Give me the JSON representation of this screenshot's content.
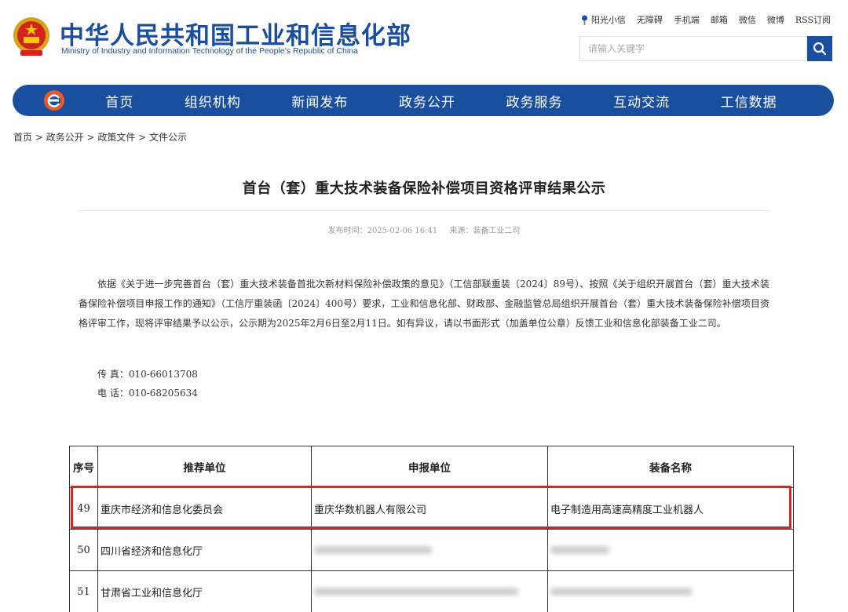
{
  "header": {
    "title": "中华人民共和国工业和信息化部",
    "subtitle": "Ministry of Industry and Information Technology of the People’s Republic of China",
    "emblem_icon": "national-emblem-icon",
    "top_links": [
      "阳光小信",
      "无障碍",
      "手机端",
      "邮箱",
      "微信",
      "微博",
      "RSS订阅"
    ],
    "search": {
      "placeholder": "请输入关键字"
    }
  },
  "nav": {
    "logo_icon": "e-logo-icon",
    "items": [
      "首页",
      "组织机构",
      "新闻发布",
      "政务公开",
      "政务服务",
      "互动交流",
      "工信数据"
    ]
  },
  "breadcrumb": "首页 > 政务公开 > 政策文件 > 文件公示",
  "article": {
    "title": "首台（套）重大技术装备保险补偿项目资格评审结果公示",
    "publish_time": "发布时间：2025-02-06 16:41",
    "source": "来源：装备工业二司",
    "body": "依据《关于进一步完善首台（套）重大技术装备首批次新材料保险补偿政策的意见》（工信部联重装〔2024〕89号）、按照《关于组织开展首台（套）重大技术装备保险补偿项目申报工作的通知》（工信厅重装函〔2024〕400号）要求，工业和信息化部、财政部、金融监管总局组织开展首台（套）重大技术装备保险补偿项目资格评审工作，现将评审结果予以公示，公示期为2025年2月6日至2月11日。如有异议，请以书面形式（加盖单位公章）反馈工业和信息化部装备工业二司。",
    "fax": "传 真：010-66013708",
    "phone": "电 话：010-68205634"
  },
  "table": {
    "headers": [
      "序号",
      "推荐单位",
      "申报单位",
      "装备名称"
    ],
    "rows": [
      {
        "num": "49",
        "recommender": "重庆市经济和信息化委员会",
        "applicant": "重庆华数机器人有限公司",
        "equipment": "电子制造用高速高精度工业机器人"
      },
      {
        "num": "50",
        "recommender": "四川省经济和信息化厅",
        "applicant": "",
        "equipment": ""
      },
      {
        "num": "51",
        "recommender": "甘肃省工业和信息化厅",
        "applicant": "",
        "equipment": ""
      }
    ]
  },
  "colors": {
    "brand_blue": "#1a4fa0",
    "highlight_red": "#e12222"
  }
}
